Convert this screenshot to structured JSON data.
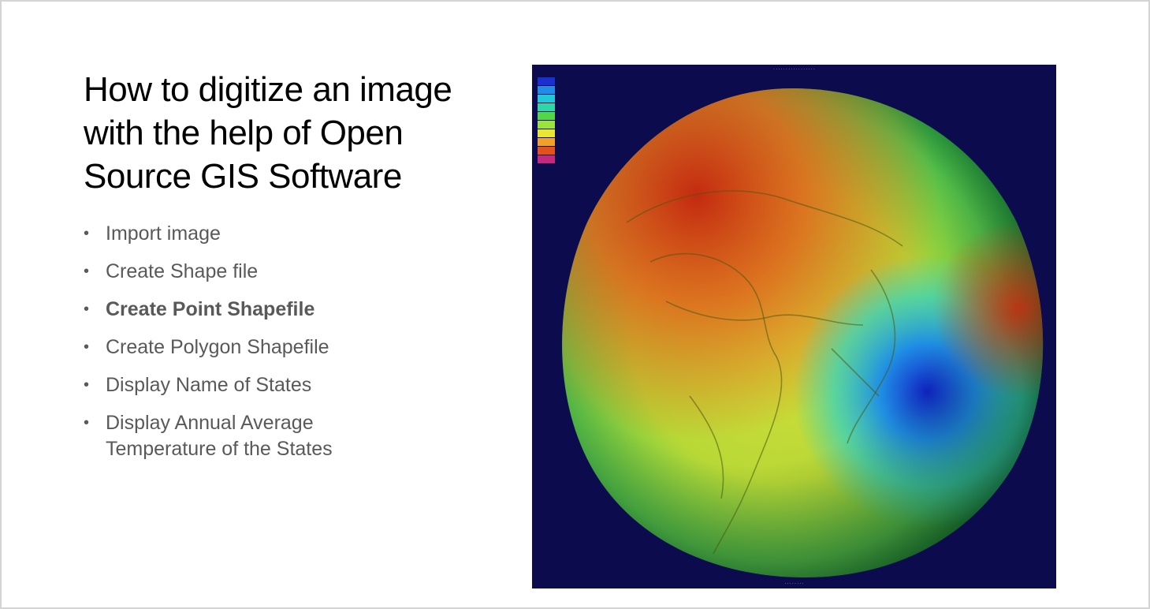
{
  "slide": {
    "title": "How to digitize an image with the help of Open Source GIS Software",
    "bullets": [
      {
        "text": "Import image",
        "bold": false
      },
      {
        "text": "Create Shape file",
        "bold": false
      },
      {
        "text": "Create Point Shapefile",
        "bold": true
      },
      {
        "text": "Create Polygon Shapefile",
        "bold": false
      },
      {
        "text": "Display Name of States",
        "bold": false
      },
      {
        "text": "Display Annual Average Temperature of the States",
        "bold": false
      }
    ],
    "bullet_glyph": "•"
  },
  "figure": {
    "icon": "geoid-globe-image",
    "background_color": "#0b0b4e",
    "legend_colors": [
      "#1a2fd0",
      "#1e8ce8",
      "#22c7d9",
      "#2fd6a6",
      "#53d64a",
      "#9be33a",
      "#e8e534",
      "#f3a126",
      "#e2521f",
      "#c8287a"
    ]
  }
}
